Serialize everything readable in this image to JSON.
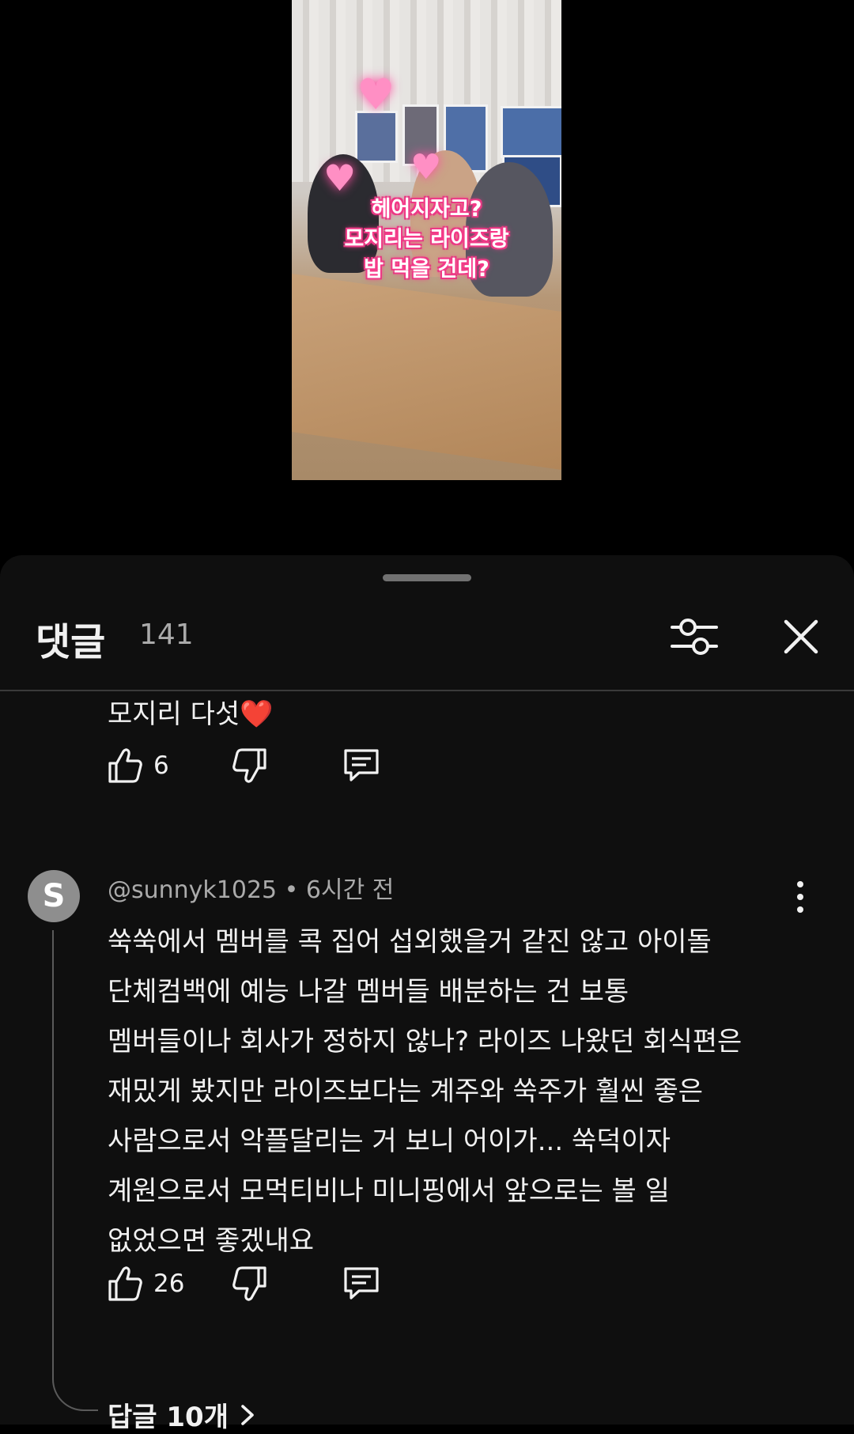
{
  "video": {
    "caption_lines": [
      "헤어지자고?",
      "모지리는 라이즈랑",
      "밥 먹을 건데?"
    ]
  },
  "comments_sheet": {
    "title": "댓글",
    "count": "141",
    "filter_icon": "sliders-icon",
    "close_icon": "close-icon"
  },
  "comments": [
    {
      "text_lines": [
        "모지리 다섯❤️"
      ],
      "likes": "6"
    },
    {
      "avatar_letter": "S",
      "author": "@sunnyk1025",
      "time": "6시간 전",
      "meta": "@sunnyk1025 • 6시간 전",
      "text_lines": [
        "쑥쑥에서 멤버를 콕 집어 섭외했을거 같진 않고 아이돌",
        "단체컴백에 예능 나갈 멤버들 배분하는 건 보통",
        "멤버들이나 회사가 정하지 않나? 라이즈 나왔던 회식편은",
        "재밌게 봤지만 라이즈보다는 계주와 쑥주가 훨씬 좋은",
        "사람으로서 악플달리는 거 보니 어이가... 쑥덕이자",
        "계원으로서 모먹티비나 미니핑에서 앞으로는 볼 일",
        "없었으면 좋겠내요"
      ],
      "likes": "26",
      "replies_label": "답글 10개"
    }
  ],
  "icons": {
    "like": "thumbs-up-icon",
    "dislike": "thumbs-down-icon",
    "reply": "reply-icon",
    "more": "more-vertical-icon",
    "chevron": "chevron-right-icon"
  }
}
